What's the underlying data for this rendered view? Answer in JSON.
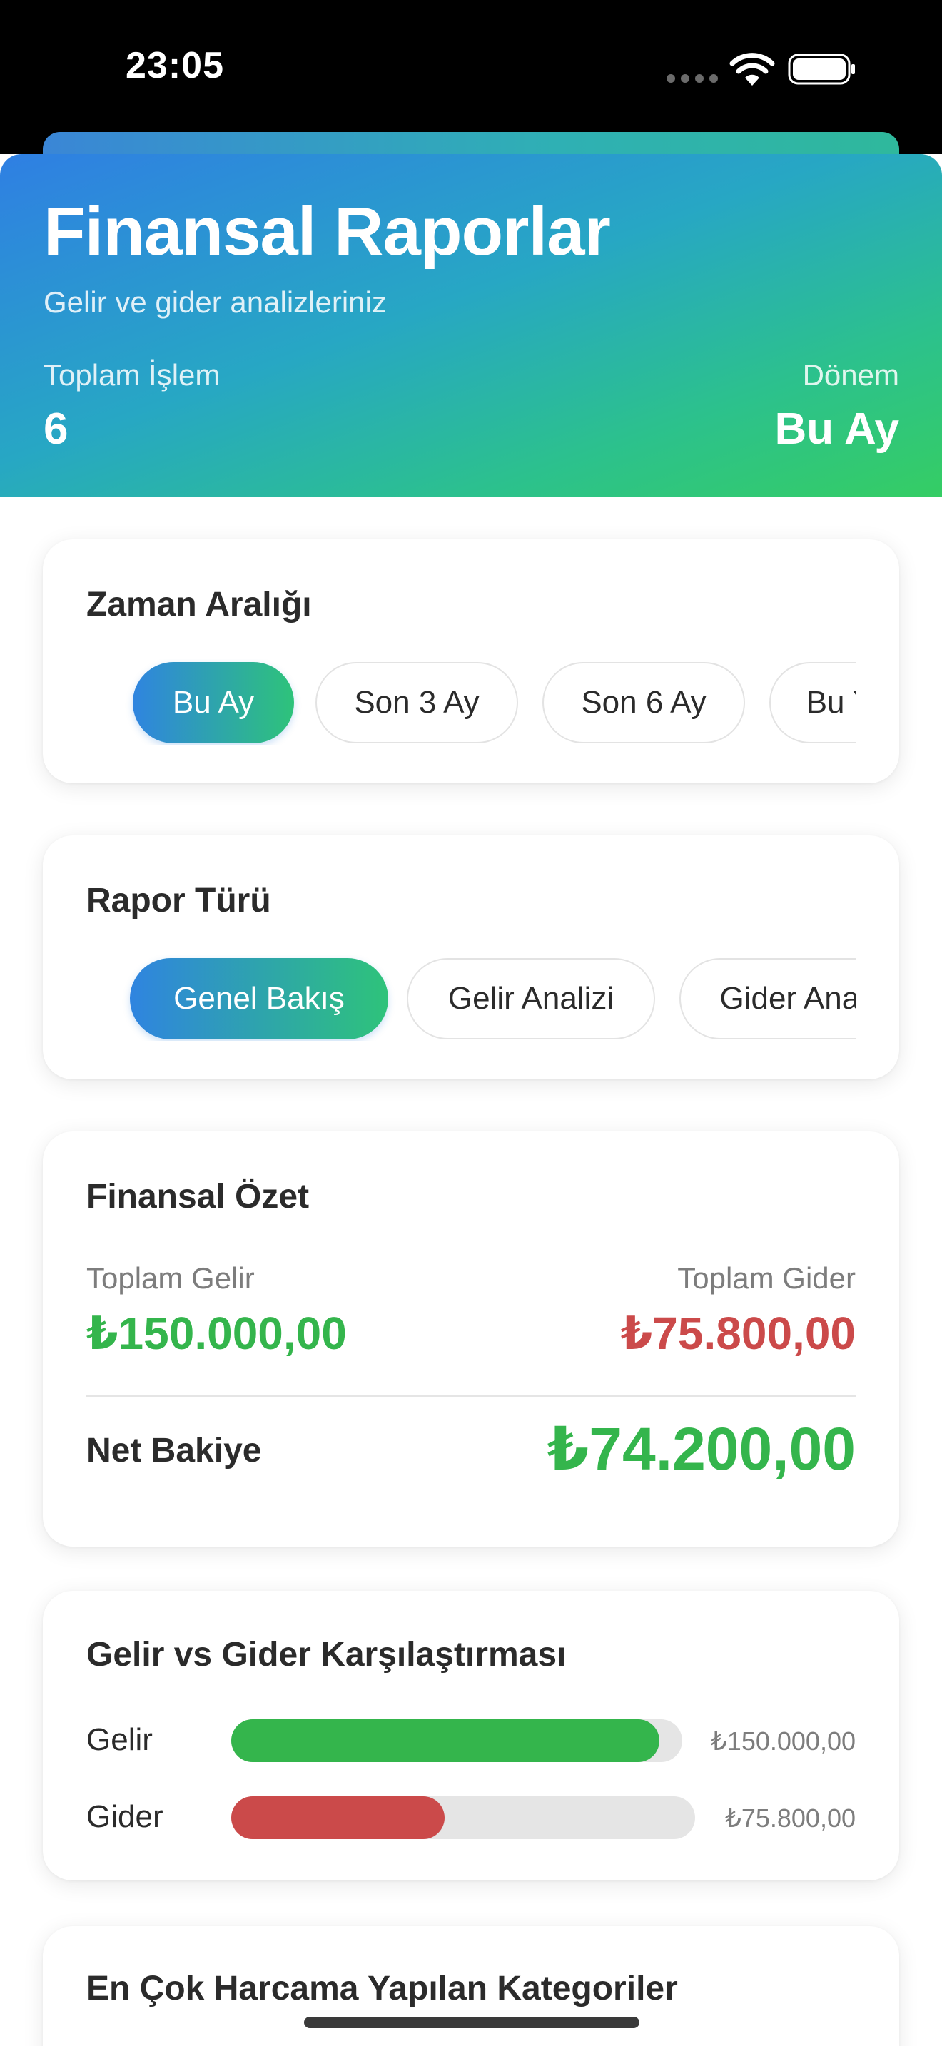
{
  "status_bar": {
    "time": "23:05"
  },
  "header": {
    "title": "Finansal Raporlar",
    "subtitle": "Gelir ve gider analizleriniz",
    "total_label": "Toplam İşlem",
    "total_value": "6",
    "period_label": "Dönem",
    "period_value": "Bu Ay"
  },
  "time_range": {
    "title": "Zaman Aralığı",
    "options": [
      "Bu Ay",
      "Son 3 Ay",
      "Son 6 Ay",
      "Bu Yıl"
    ],
    "selected": "Bu Ay"
  },
  "report_type": {
    "title": "Rapor Türü",
    "options": [
      "Genel Bakış",
      "Gelir Analizi",
      "Gider Analizi"
    ],
    "selected": "Genel Bakış"
  },
  "summary": {
    "title": "Finansal Özet",
    "income_label": "Toplam Gelir",
    "income_value": "₺150.000,00",
    "expense_label": "Toplam Gider",
    "expense_value": "₺75.800,00",
    "net_label": "Net Bakiye",
    "net_value": "₺74.200,00"
  },
  "comparison": {
    "title": "Gelir vs Gider Karşılaştırması",
    "rows": [
      {
        "label": "Gelir",
        "amount": "₺150.000,00",
        "fraction": 0.95,
        "color": "#34b54c"
      },
      {
        "label": "Gider",
        "amount": "₺75.800,00",
        "fraction": 0.46,
        "color": "#cb4a4a"
      }
    ]
  },
  "categories": {
    "title": "En Çok Harcama Yapılan Kategoriler"
  },
  "colors": {
    "income": "#34b54c",
    "expense": "#cb4a4a",
    "gradient_start": "#2f7fe3",
    "gradient_end": "#35cd64"
  }
}
